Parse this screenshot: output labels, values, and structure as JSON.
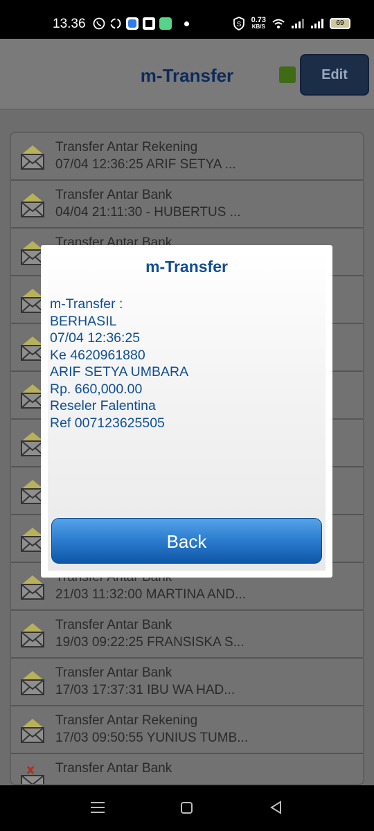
{
  "status_bar": {
    "time": "13.36",
    "net_speed_value": "0.73",
    "net_speed_unit": "KB/S",
    "battery": "69"
  },
  "app": {
    "title": "m-Transfer",
    "edit_label": "Edit",
    "accent": "#0f4e96"
  },
  "list": [
    {
      "line1": "Transfer Antar Rekening",
      "line2": "07/04 12:36:25 ARIF SETYA ...",
      "icon": "envelope-icon"
    },
    {
      "line1": "Transfer Antar Bank",
      "line2": "04/04 21:11:30 - HUBERTUS ...",
      "icon": "envelope-icon"
    },
    {
      "line1": "Transfer Antar Bank",
      "line2": "",
      "icon": "envelope-icon"
    },
    {
      "line1": "",
      "line2": "",
      "icon": "envelope-icon"
    },
    {
      "line1": "",
      "line2": "",
      "icon": "envelope-icon"
    },
    {
      "line1": "",
      "line2": "",
      "icon": "envelope-icon"
    },
    {
      "line1": "",
      "line2": "",
      "icon": "envelope-icon"
    },
    {
      "line1": "",
      "line2": "",
      "icon": "envelope-icon"
    },
    {
      "line1": "",
      "line2": "",
      "icon": "envelope-icon"
    },
    {
      "line1": "Transfer Antar Bank",
      "line2": "21/03 11:32:00 MARTINA AND...",
      "icon": "envelope-icon"
    },
    {
      "line1": "Transfer Antar Bank",
      "line2": "19/03 09:22:25 FRANSISKA S...",
      "icon": "envelope-icon"
    },
    {
      "line1": "Transfer Antar Bank",
      "line2": "17/03 17:37:31 IBU WA  HAD...",
      "icon": "envelope-icon"
    },
    {
      "line1": "Transfer Antar Rekening",
      "line2": "17/03 09:50:55 YUNIUS TUMB...",
      "icon": "envelope-icon"
    },
    {
      "line1": "Transfer Antar Bank",
      "line2": "",
      "icon": "envelope-error-icon"
    }
  ],
  "dialog": {
    "title": "m-Transfer",
    "lines": [
      "m-Transfer :",
      "BERHASIL",
      "07/04 12:36:25",
      "Ke 4620961880",
      "ARIF SETYA UMBARA",
      "Rp. 660,000.00",
      "Reseler Falentina",
      "Ref 007123625505"
    ],
    "back_label": "Back"
  }
}
